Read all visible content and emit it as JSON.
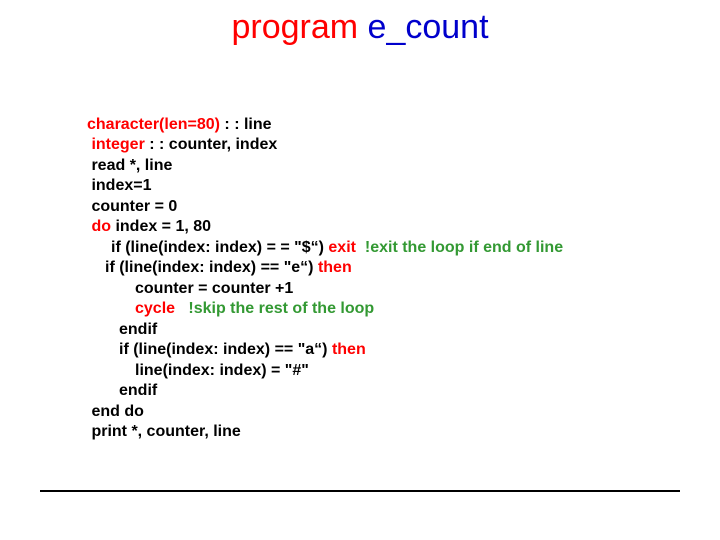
{
  "title": {
    "word1": "program",
    "word2": "e_count"
  },
  "code": {
    "l1a": "character(len=80)",
    "l1b": " : : line",
    "l2a": " integer",
    "l2b": " : : counter, index",
    "l3": " read *, line",
    "l4": " index=1",
    "l5": " counter = 0",
    "l6a": " do",
    "l6b": " index = 1, 80",
    "l7a": "if (line(index: index) = = \"$“) ",
    "l7b": "exit",
    "l7c": "  !exit the loop if end of line",
    "l8a": "if (line(index: index) == \"e“) ",
    "l8b": "then",
    "l9": "counter = counter +1",
    "l10a": "cycle",
    "l10b": "   !skip the rest of the loop",
    "l11": "endif",
    "l12a": "if (line(index: index) == \"a“) ",
    "l12b": "then",
    "l13": "line(index: index) = \"#\"",
    "l14": "endif",
    "l15": " end do",
    "l16": " print *, counter, line"
  }
}
